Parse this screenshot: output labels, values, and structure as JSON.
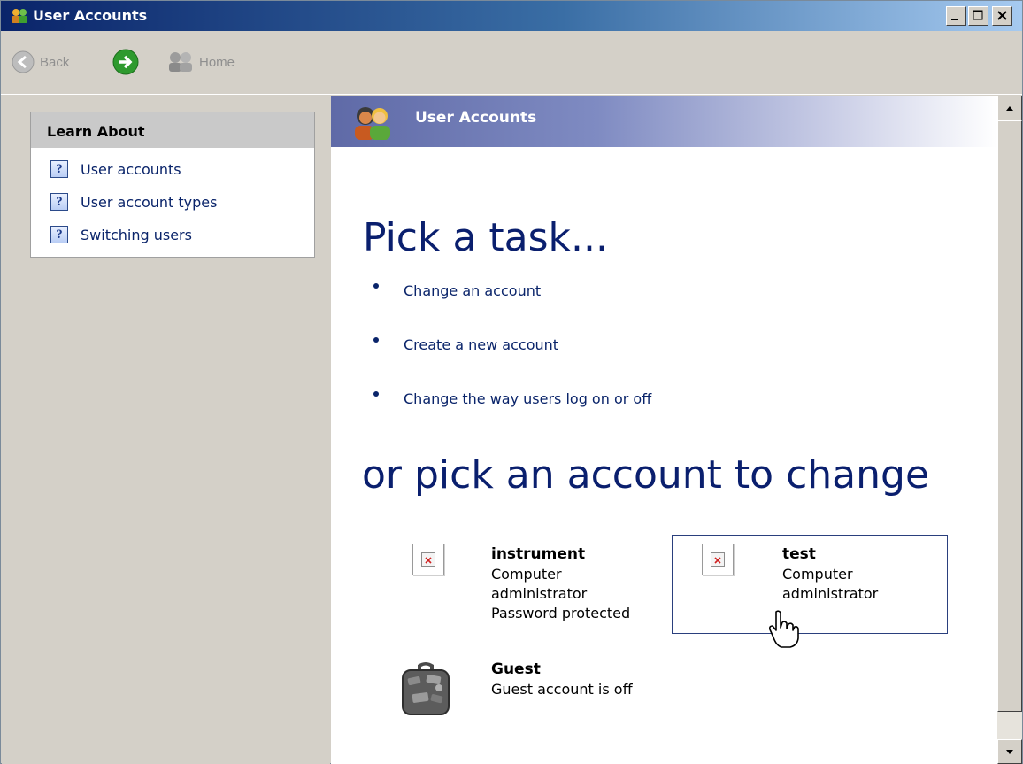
{
  "window": {
    "title": "User Accounts"
  },
  "toolbar": {
    "back_label": "Back",
    "home_label": "Home"
  },
  "learn_about": {
    "heading": "Learn About",
    "items": [
      {
        "label": "User accounts"
      },
      {
        "label": "User account types"
      },
      {
        "label": "Switching users"
      }
    ]
  },
  "main": {
    "header_title": "User Accounts",
    "pick_task_heading": "Pick a task...",
    "tasks": [
      {
        "label": "Change an account"
      },
      {
        "label": "Create a new account"
      },
      {
        "label": "Change the way users log on or off"
      }
    ],
    "pick_account_heading": "or pick an account to change",
    "accounts": [
      {
        "name": "instrument",
        "lines": [
          "Computer",
          "administrator",
          "Password protected"
        ]
      },
      {
        "name": "test",
        "lines": [
          "Computer",
          "administrator"
        ]
      },
      {
        "name": "Guest",
        "lines": [
          "Guest account is off"
        ]
      }
    ]
  },
  "icons": {
    "title": "users-icon",
    "back": "back-arrow-icon",
    "forward": "forward-arrow-icon",
    "home": "home-icon",
    "help": "help-icon",
    "header": "users-icon",
    "account_picture": "broken-image-icon",
    "guest_picture": "suitcase-icon",
    "cursor": "hand-pointer-icon"
  }
}
